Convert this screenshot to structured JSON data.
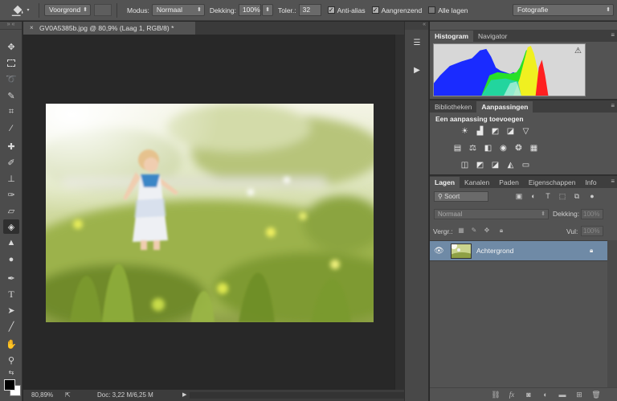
{
  "options_bar": {
    "fill_source": "Voorgrond",
    "mode_label": "Modus:",
    "mode_value": "Normaal",
    "opacity_label": "Dekking:",
    "opacity_value": "100%",
    "tolerance_label": "Toler.:",
    "tolerance_value": "32",
    "anti_alias_label": "Anti-alias",
    "anti_alias_checked": true,
    "contiguous_label": "Aangrenzend",
    "contiguous_checked": true,
    "all_layers_label": "Alle lagen",
    "all_layers_checked": false,
    "workspace": "Fotografie"
  },
  "document": {
    "tab_title": "GV0A5385b.jpg @ 80,9% (Laag 1, RGB/8) *",
    "close_glyph": "×"
  },
  "status_bar": {
    "zoom": "80,89%",
    "doc_info": "Doc: 3,22 M/6,25 M"
  },
  "panels": {
    "top_tabs": [
      "Histogram",
      "Navigator"
    ],
    "middle_tabs": [
      "Bibliotheken",
      "Aanpassingen"
    ],
    "adjustments_title": "Een aanpassing toevoegen",
    "layers_tabs": [
      "Lagen",
      "Kanalen",
      "Paden",
      "Eigenschappen",
      "Info"
    ],
    "layer_filter": "Soort",
    "blend_mode": "Normaal",
    "opacity_label": "Dekking:",
    "opacity_value": "100%",
    "lock_label": "Vergr.:",
    "fill_label": "Vul:",
    "fill_value": "100%",
    "layers": [
      {
        "name": "Achtergrond",
        "visible": true,
        "locked": true,
        "selected": true
      }
    ]
  },
  "colors": {
    "selected_layer": "#6f8aa6",
    "ui_panel": "#535353",
    "canvas_bg": "#282828"
  }
}
